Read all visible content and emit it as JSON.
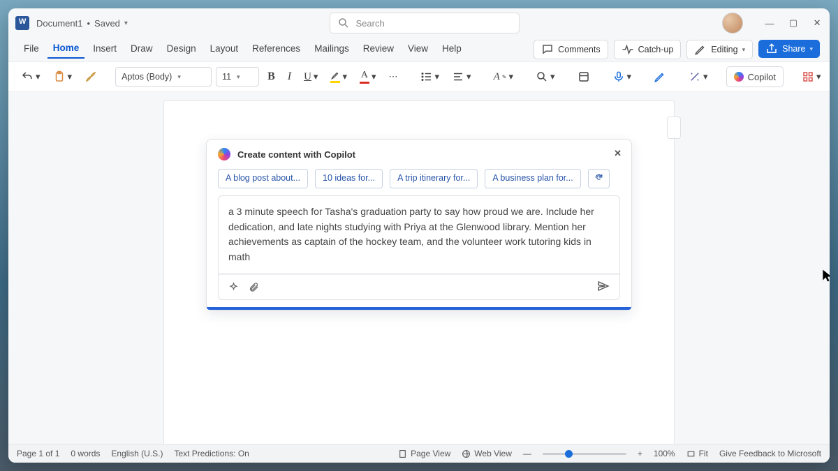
{
  "title": {
    "doc_name": "Document1",
    "save_status": "Saved"
  },
  "search": {
    "placeholder": "Search"
  },
  "menu": {
    "tabs": [
      "File",
      "Home",
      "Insert",
      "Draw",
      "Design",
      "Layout",
      "References",
      "Mailings",
      "Review",
      "View",
      "Help"
    ],
    "active_index": 1
  },
  "actions": {
    "comments": "Comments",
    "catchup": "Catch-up",
    "editing": "Editing",
    "share": "Share"
  },
  "ribbon": {
    "font_name": "Aptos (Body)",
    "font_size": "11",
    "copilot_label": "Copilot"
  },
  "copilot": {
    "title": "Create content with Copilot",
    "suggestions": [
      "A blog post about...",
      "10 ideas for...",
      "A trip itinerary for...",
      "A business plan for..."
    ],
    "prompt": "a 3 minute speech for Tasha's graduation party to say how proud we are. Include her dedication, and late nights studying with Priya at the Glenwood library. Mention her achievements as captain of the hockey team, and the volunteer work tutoring kids in math"
  },
  "status": {
    "page": "Page 1 of 1",
    "words": "0 words",
    "lang": "English (U.S.)",
    "predictions": "Text Predictions: On",
    "page_view": "Page View",
    "web_view": "Web View",
    "zoom": "100%",
    "fit": "Fit",
    "feedback": "Give Feedback to Microsoft"
  }
}
